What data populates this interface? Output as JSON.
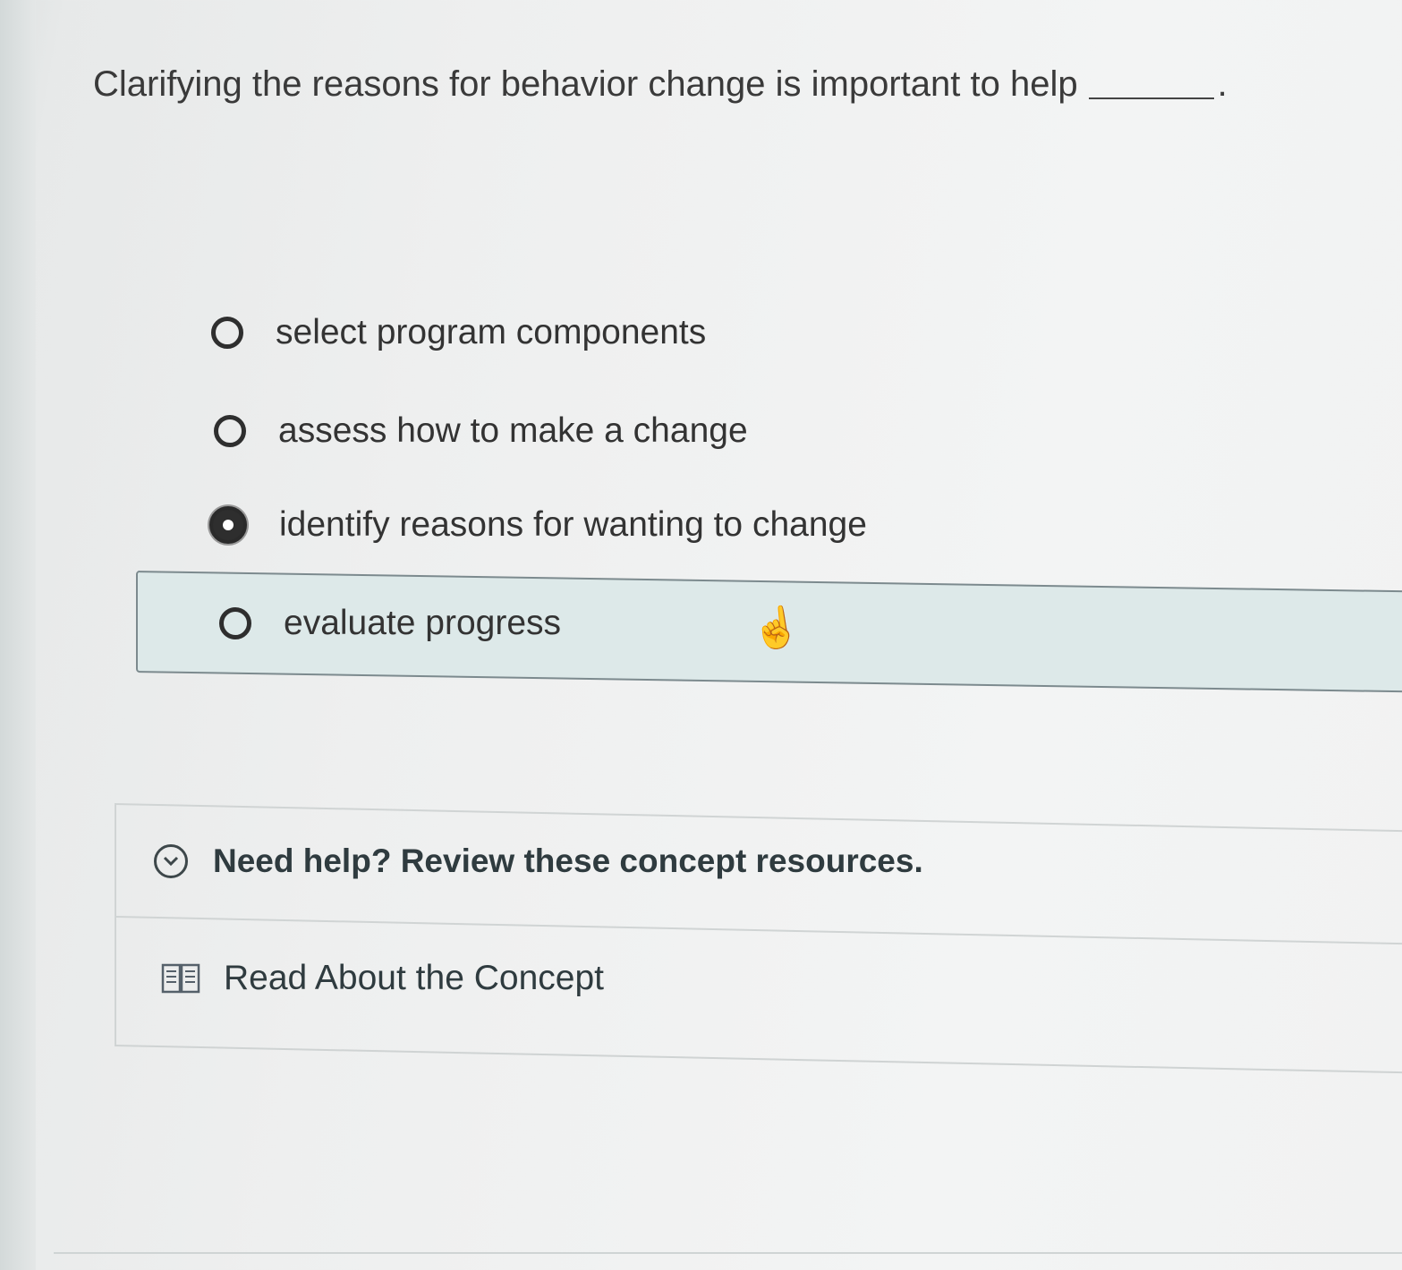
{
  "question": {
    "text": "Clarifying the reasons for behavior change is important to help",
    "end": "."
  },
  "options": [
    {
      "label": "select program components",
      "selected": false
    },
    {
      "label": "assess how to make a change",
      "selected": false
    },
    {
      "label": "identify reasons for wanting to change",
      "selected": true
    },
    {
      "label": "evaluate progress",
      "selected": false,
      "hovered": true
    }
  ],
  "help": {
    "header": "Need help? Review these concept resources.",
    "link": "Read About the Concept"
  },
  "icons": {
    "radio": "radio-button-icon",
    "cursor": "hand-pointer-icon",
    "chevron": "chevron-down-circle-icon",
    "book": "open-book-icon"
  }
}
